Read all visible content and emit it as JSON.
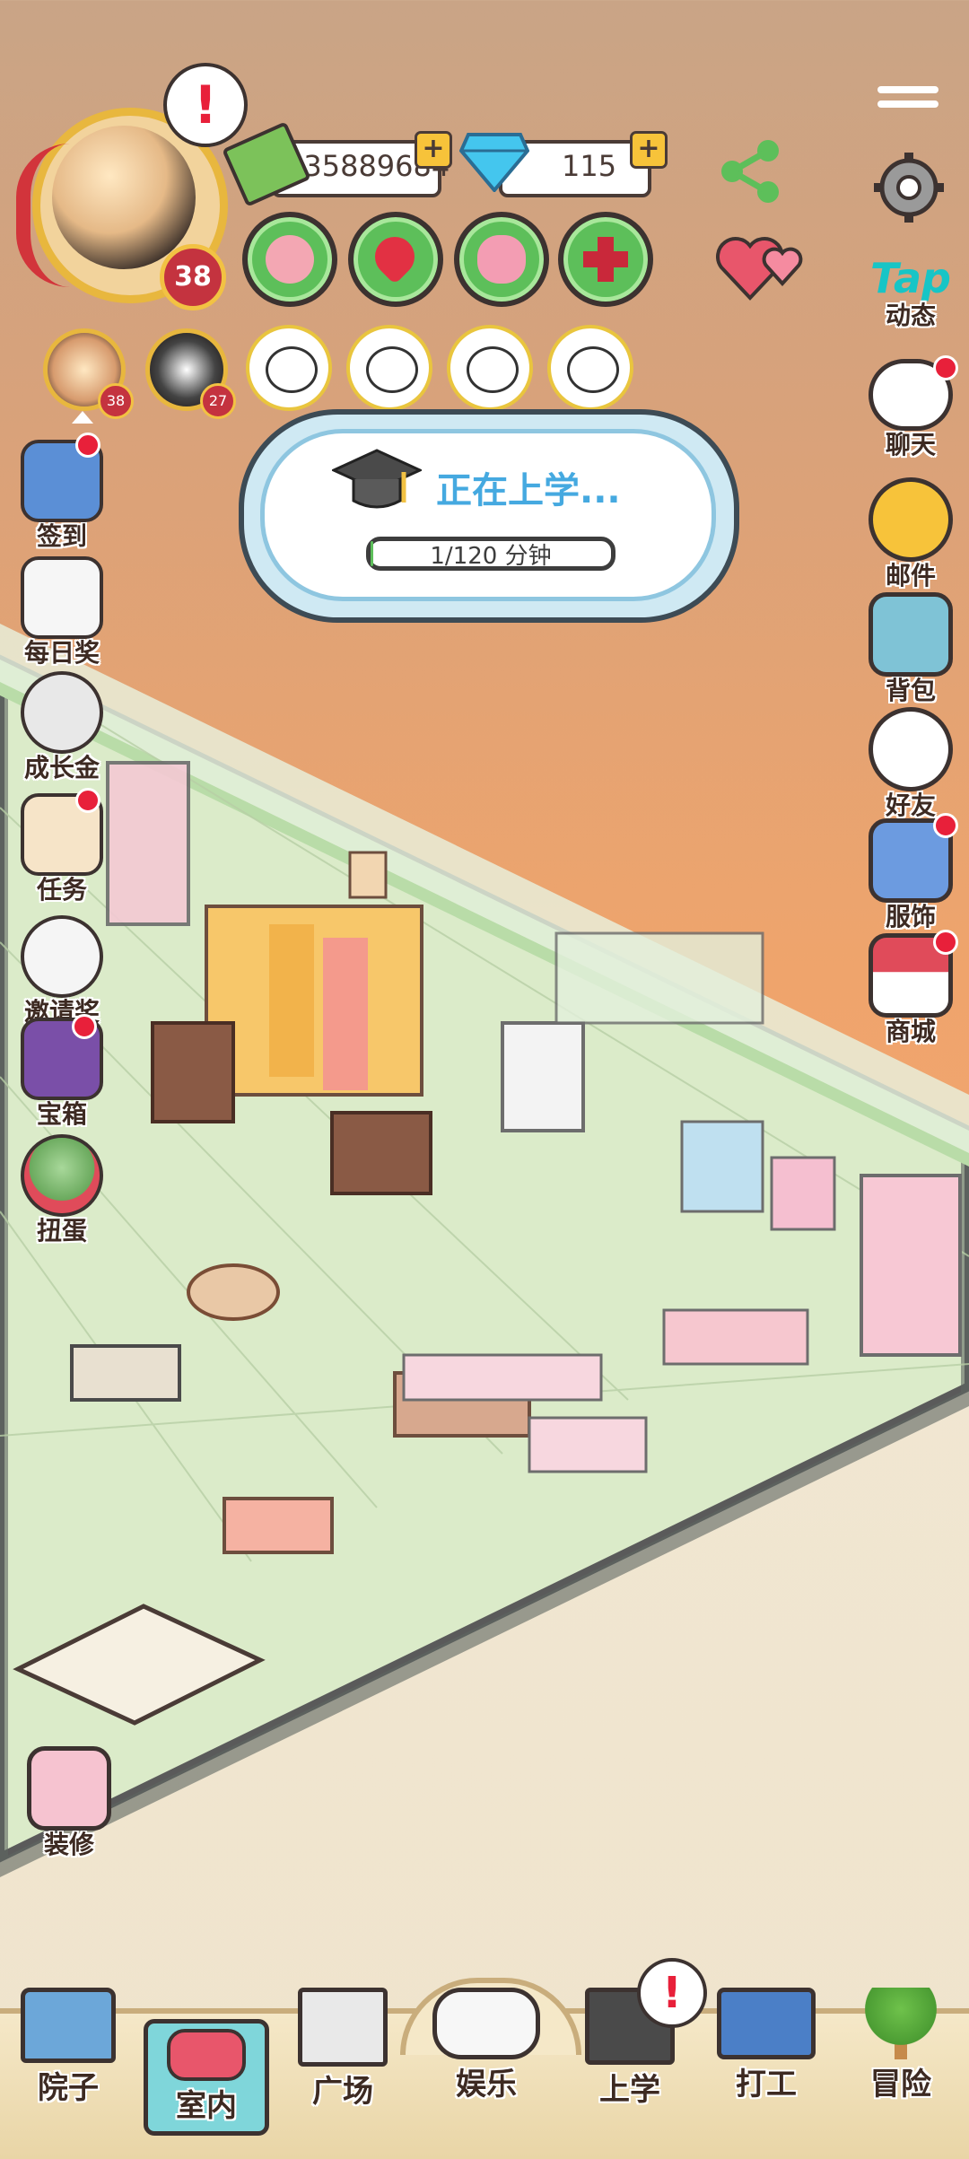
{
  "player": {
    "level": "38"
  },
  "friends": [
    {
      "level": "38"
    },
    {
      "level": "27"
    }
  ],
  "currency": {
    "money": "235889684",
    "diamonds": "115"
  },
  "stats": [
    {
      "icon": "meat-icon"
    },
    {
      "icon": "heart-icon"
    },
    {
      "icon": "brain-icon"
    },
    {
      "icon": "health-plus-icon"
    }
  ],
  "school_popup": {
    "title": "正在上学...",
    "progress": "1/120 分钟",
    "progress_value": 0.01
  },
  "left_menu": [
    "签到",
    "每日奖",
    "成长金",
    "任务",
    "邀请奖",
    "宝箱",
    "扭蛋"
  ],
  "right_menu": [
    "动态",
    "聊天",
    "邮件",
    "背包",
    "好友",
    "服饰",
    "商城"
  ],
  "tap_logo": "Tap",
  "decorate": "装修",
  "bottom_nav": [
    "院子",
    "室内",
    "广场",
    "娱乐",
    "上学",
    "打工",
    "冒险"
  ],
  "colors": {
    "accent_green": "#5dbf5a",
    "alert_red": "#e8203a",
    "tap_cyan": "#17c5c6",
    "selected_tab": "#7fd6da"
  }
}
